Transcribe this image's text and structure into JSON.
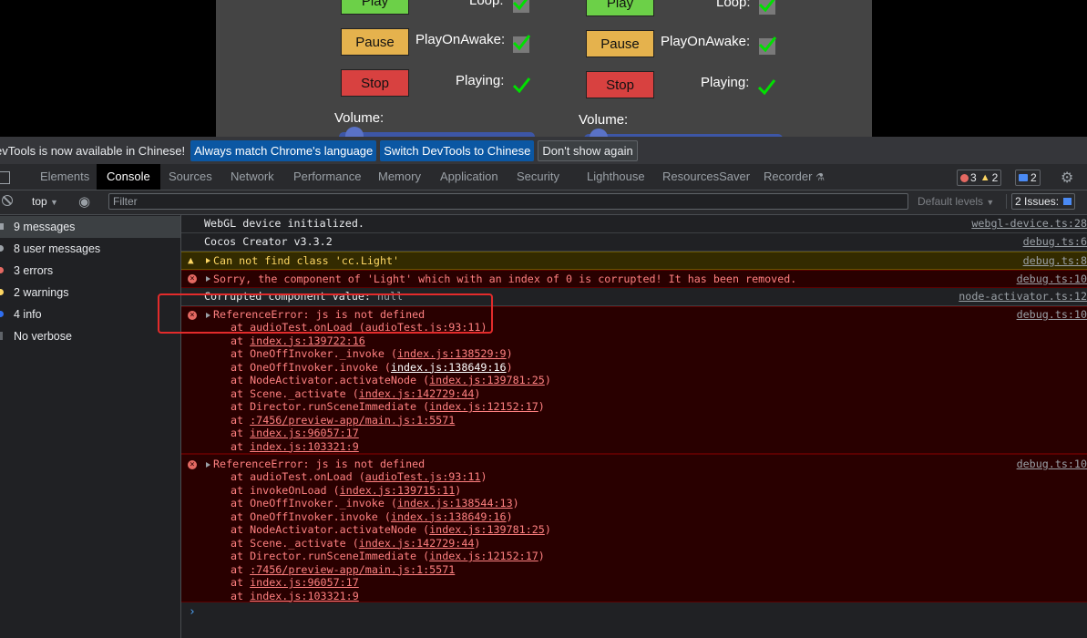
{
  "preview": {
    "left": {
      "play_label": "Play",
      "pause_label": "Pause",
      "stop_label": "Stop",
      "loop_label": "Loop:",
      "playonawake_label": "PlayOnAwake:",
      "playing_label": "Playing:",
      "volume_label": "Volume:"
    },
    "right": {
      "play_label": "Play",
      "pause_label": "Pause",
      "stop_label": "Stop",
      "loop_label": "Loop:",
      "playonawake_label": "PlayOnAwake:",
      "playing_label": "Playing:",
      "volume_label": "Volume:"
    },
    "colors": {
      "play": "#6cd048",
      "pause": "#e5b24d",
      "stop": "#d84140",
      "check": "#00e000"
    }
  },
  "infobar": {
    "message": "evTools is now available in Chinese!",
    "btn_match": "Always match Chrome's language",
    "btn_switch": "Switch DevTools to Chinese",
    "btn_dismiss": "Don't show again"
  },
  "tabs": {
    "elements": "Elements",
    "console": "Console",
    "sources": "Sources",
    "network": "Network",
    "performance": "Performance",
    "memory": "Memory",
    "application": "Application",
    "security": "Security",
    "lighthouse": "Lighthouse",
    "resourcessaver": "ResourcesSaver",
    "recorder": "Recorder"
  },
  "counts": {
    "errors": "3",
    "warnings": "2",
    "messages": "2"
  },
  "toolbar": {
    "context": "top",
    "filter_placeholder": "Filter",
    "levels": "Default levels",
    "issues": "2 Issues:",
    "issues_count": "2"
  },
  "sidebar": {
    "items": [
      {
        "label": "9 messages"
      },
      {
        "label": "8 user messages"
      },
      {
        "label": "3 errors"
      },
      {
        "label": "2 warnings"
      },
      {
        "label": "4 info"
      },
      {
        "label": "No verbose"
      }
    ]
  },
  "console": {
    "rows": [
      {
        "text": "WebGL device initialized.",
        "source": "webgl-device.ts:28"
      },
      {
        "text": "Cocos Creator v3.3.2",
        "source": "debug.ts:6"
      },
      {
        "text": "Can not find class 'cc.Light'",
        "source": "debug.ts:8"
      },
      {
        "text": "Sorry, the component of 'Light' which with an index of 0 is corrupted! It has been removed.",
        "source": "debug.ts:10"
      },
      {
        "text": "Corrupted component value:",
        "extra": "null",
        "source": "node-activator.ts:12"
      },
      {
        "text": "ReferenceError: js is not defined",
        "source": "debug.ts:10"
      },
      {
        "text": "ReferenceError: js is not defined",
        "source": "debug.ts:10"
      }
    ],
    "stack1": [
      {
        "pre": "at audioTest.onLoad (",
        "link": "audioTest.js:93:11",
        "post": ")"
      },
      {
        "pre": "at ",
        "link": "index.js:139722:16",
        "post": ""
      },
      {
        "pre": "at OneOffInvoker._invoke (",
        "link": "index.js:138529:9",
        "post": ")"
      },
      {
        "pre": "at OneOffInvoker.invoke (",
        "link": "index.js:138649:16",
        "post": ")"
      },
      {
        "pre": "at NodeActivator.activateNode (",
        "link": "index.js:139781:25",
        "post": ")"
      },
      {
        "pre": "at Scene._activate (",
        "link": "index.js:142729:44",
        "post": ")"
      },
      {
        "pre": "at Director.runSceneImmediate (",
        "link": "index.js:12152:17",
        "post": ")"
      },
      {
        "pre": "at ",
        "link": ":7456/preview-app/main.js:1:5571",
        "post": ""
      },
      {
        "pre": "at ",
        "link": "index.js:96057:17",
        "post": ""
      },
      {
        "pre": "at ",
        "link": "index.js:103321:9",
        "post": ""
      }
    ],
    "stack2": [
      {
        "pre": "at audioTest.onLoad (",
        "link": "audioTest.js:93:11",
        "post": ")"
      },
      {
        "pre": "at invokeOnLoad (",
        "link": "index.js:139715:11",
        "post": ")"
      },
      {
        "pre": "at OneOffInvoker._invoke (",
        "link": "index.js:138544:13",
        "post": ")"
      },
      {
        "pre": "at OneOffInvoker.invoke (",
        "link": "index.js:138649:16",
        "post": ")"
      },
      {
        "pre": "at NodeActivator.activateNode (",
        "link": "index.js:139781:25",
        "post": ")"
      },
      {
        "pre": "at Scene._activate (",
        "link": "index.js:142729:44",
        "post": ")"
      },
      {
        "pre": "at Director.runSceneImmediate (",
        "link": "index.js:12152:17",
        "post": ")"
      },
      {
        "pre": "at ",
        "link": ":7456/preview-app/main.js:1:5571",
        "post": ""
      },
      {
        "pre": "at ",
        "link": "index.js:96057:17",
        "post": ""
      },
      {
        "pre": "at ",
        "link": "index.js:103321:9",
        "post": ""
      }
    ],
    "prompt": "›"
  }
}
